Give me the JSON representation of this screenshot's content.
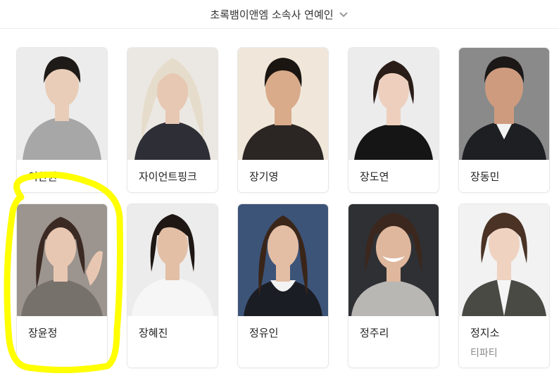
{
  "header": {
    "title": "초록뱀이앤엠 소속사 연예인",
    "icon": "chevron-down-icon"
  },
  "people": [
    {
      "name": "이찬원",
      "bg": "#ececec",
      "hair": "#1e1a17",
      "skin": "#e9cdb8",
      "shirt": "#a7a7a7"
    },
    {
      "name": "자이언트핑크",
      "bg": "#ebe8e3",
      "hair": "#e6dccb",
      "skin": "#e7c8b3",
      "shirt": "#2e2f36"
    },
    {
      "name": "장기영",
      "bg": "#f0e7da",
      "hair": "#1b1512",
      "skin": "#d9ab8a",
      "shirt": "#2b2523"
    },
    {
      "name": "장도연",
      "bg": "#ececec",
      "hair": "#2a1d17",
      "skin": "#eecfbd",
      "shirt": "#151515"
    },
    {
      "name": "장동민",
      "bg": "#8a8a8a",
      "hair": "#1b1817",
      "skin": "#cf9b7e",
      "shirt": "#1d1f23"
    },
    {
      "name": "장윤정",
      "bg": "#9c948e",
      "hair": "#3b2a23",
      "skin": "#e8c7b2",
      "shirt": "#77716b"
    },
    {
      "name": "장혜진",
      "bg": "#ececec",
      "hair": "#1e1714",
      "skin": "#e3bfa6",
      "shirt": "#f6f6f6"
    },
    {
      "name": "정유인",
      "bg": "#3d5479",
      "hair": "#3a2519",
      "skin": "#e4bea4",
      "shirt": "#1b1d24"
    },
    {
      "name": "정주리",
      "bg": "#2f3034",
      "hair": "#3b271d",
      "skin": "#dfb79c",
      "shirt": "#b9b7b4"
    },
    {
      "name": "정지소",
      "sub": "티파티",
      "bg": "#f2f2f2",
      "hair": "#4a3225",
      "skin": "#efd2c0",
      "shirt": "#4a4a45"
    }
  ],
  "highlight": {
    "color": "#ffff00",
    "target": "장윤정"
  }
}
